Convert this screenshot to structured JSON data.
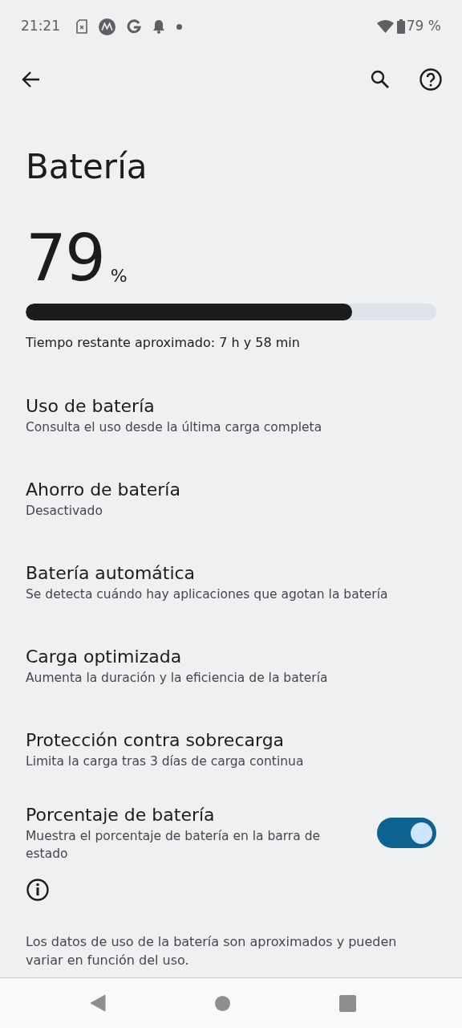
{
  "status_bar": {
    "time": "21:21",
    "battery": "79 %"
  },
  "title": "Batería",
  "battery": {
    "percent": "79",
    "unit": "%",
    "level": 0.795,
    "remaining": "Tiempo restante aproximado: 7 h y 58 min"
  },
  "items": [
    {
      "kind": "link",
      "title": "Uso de batería",
      "subtitle": "Consulta el uso desde la última carga completa"
    },
    {
      "kind": "link",
      "title": "Ahorro de batería",
      "subtitle": "Desactivado"
    },
    {
      "kind": "link",
      "title": "Batería automática",
      "subtitle": "Se detecta cuándo hay aplicaciones que agotan la batería"
    },
    {
      "kind": "link",
      "title": "Carga optimizada",
      "subtitle": "Aumenta la duración y la eficiencia de la batería"
    },
    {
      "kind": "link",
      "title": "Protección contra sobrecarga",
      "subtitle": "Limita la carga tras 3 días de carga continua"
    },
    {
      "kind": "toggle",
      "title": "Porcentaje de batería",
      "subtitle": "Muestra el porcentaje de batería en la barra de estado",
      "on": true
    }
  ],
  "footer": "Los datos de uso de la batería son aproximados y pueden variar en función del uso."
}
